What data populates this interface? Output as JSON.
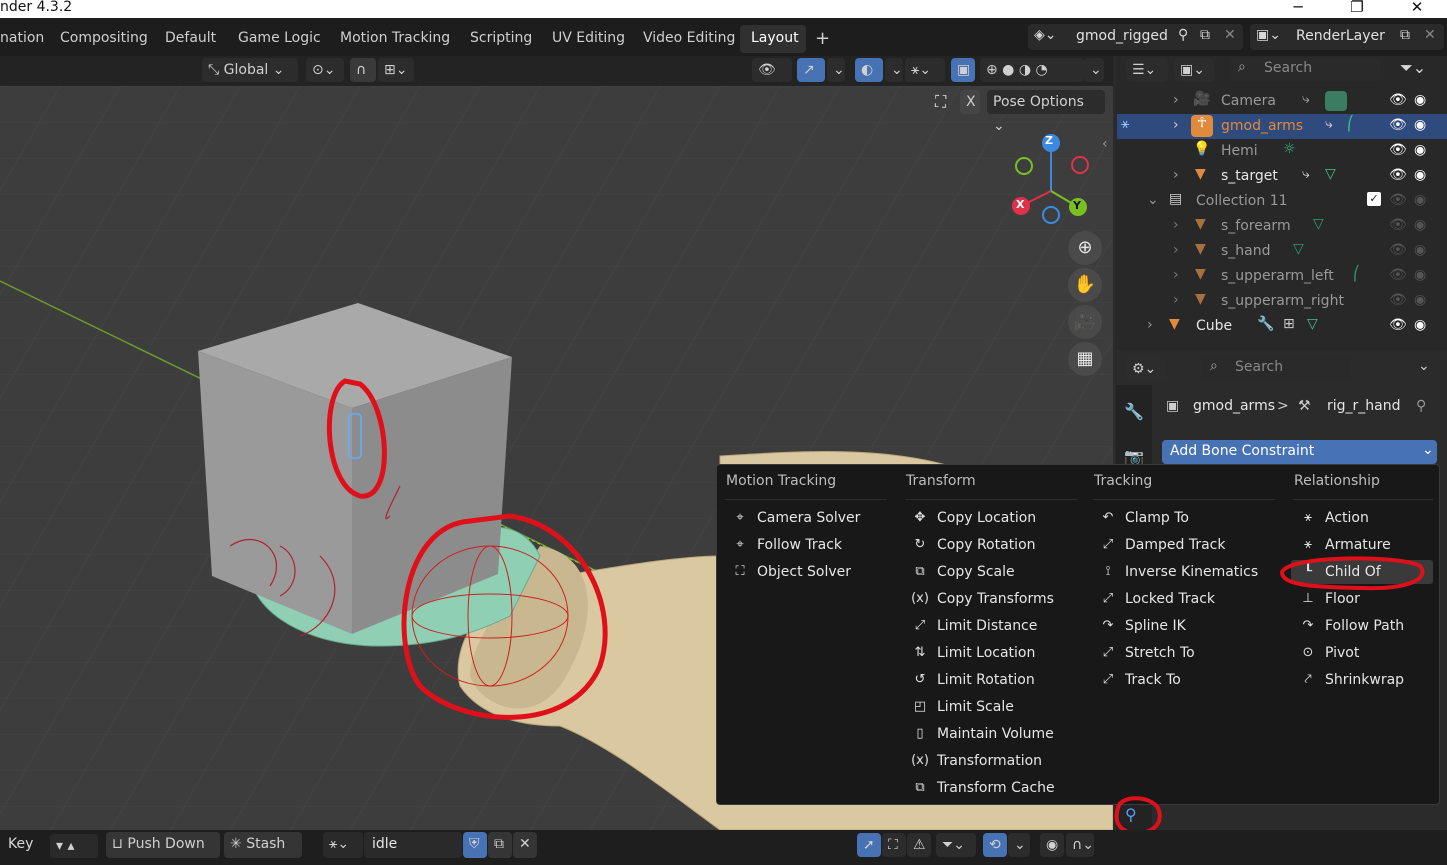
{
  "window": {
    "title": "nder 4.3.2",
    "minimize": "─",
    "maximize": "❐",
    "close": "✕"
  },
  "workspaces": [
    "nation",
    "Compositing",
    "Default",
    "Game Logic",
    "Motion Tracking",
    "Scripting",
    "UV Editing",
    "Video Editing",
    "Layout"
  ],
  "active_workspace": "Layout",
  "add_workspace": "+",
  "scene": {
    "name": "gmod_rigged"
  },
  "view_layer": {
    "name": "RenderLayer"
  },
  "viewport_header": {
    "orientation": "Global",
    "pose_options": "Pose Options",
    "x_mirror": "X"
  },
  "gizmo": {
    "z": "Z",
    "x": "X",
    "y": "Y"
  },
  "outliner": {
    "search_placeholder": "Search",
    "rows": [
      {
        "label": "Camera"
      },
      {
        "label": "gmod_arms"
      },
      {
        "label": "Hemi"
      },
      {
        "label": "s_target"
      },
      {
        "label": "Collection 11"
      },
      {
        "label": "s_forearm"
      },
      {
        "label": "s_hand"
      },
      {
        "label": "s_upperarm_left"
      },
      {
        "label": "s_upperarm_right"
      },
      {
        "label": "Cube"
      }
    ]
  },
  "properties": {
    "search_placeholder": "Search",
    "breadcrumb_object": "gmod_arms",
    "breadcrumb_sep": ">",
    "breadcrumb_bone": "rig_r_hand",
    "add_constraint": "Add Bone Constraint"
  },
  "menu": {
    "columns": [
      {
        "title": "Motion Tracking",
        "items": [
          "Camera Solver",
          "Follow Track",
          "Object Solver"
        ]
      },
      {
        "title": "Transform",
        "items": [
          "Copy Location",
          "Copy Rotation",
          "Copy Scale",
          "Copy Transforms",
          "Limit Distance",
          "Limit Location",
          "Limit Rotation",
          "Limit Scale",
          "Maintain Volume",
          "Transformation",
          "Transform Cache"
        ]
      },
      {
        "title": "Tracking",
        "items": [
          "Clamp To",
          "Damped Track",
          "Inverse Kinematics",
          "Locked Track",
          "Spline IK",
          "Stretch To",
          "Track To"
        ]
      },
      {
        "title": "Relationship",
        "items": [
          "Action",
          "Armature",
          "Child Of",
          "Floor",
          "Follow Path",
          "Pivot",
          "Shrinkwrap"
        ]
      }
    ],
    "highlighted": "Child Of"
  },
  "statusbar": {
    "key": "Key",
    "push_down": "Push Down",
    "stash": "Stash",
    "action": "idle"
  },
  "colors": {
    "accent": "#4772b3",
    "selected_row": "#2f4a7c",
    "annotation": "#e0101a",
    "object_orange": "#e08a3c",
    "mesh_green": "#3fc38c"
  }
}
